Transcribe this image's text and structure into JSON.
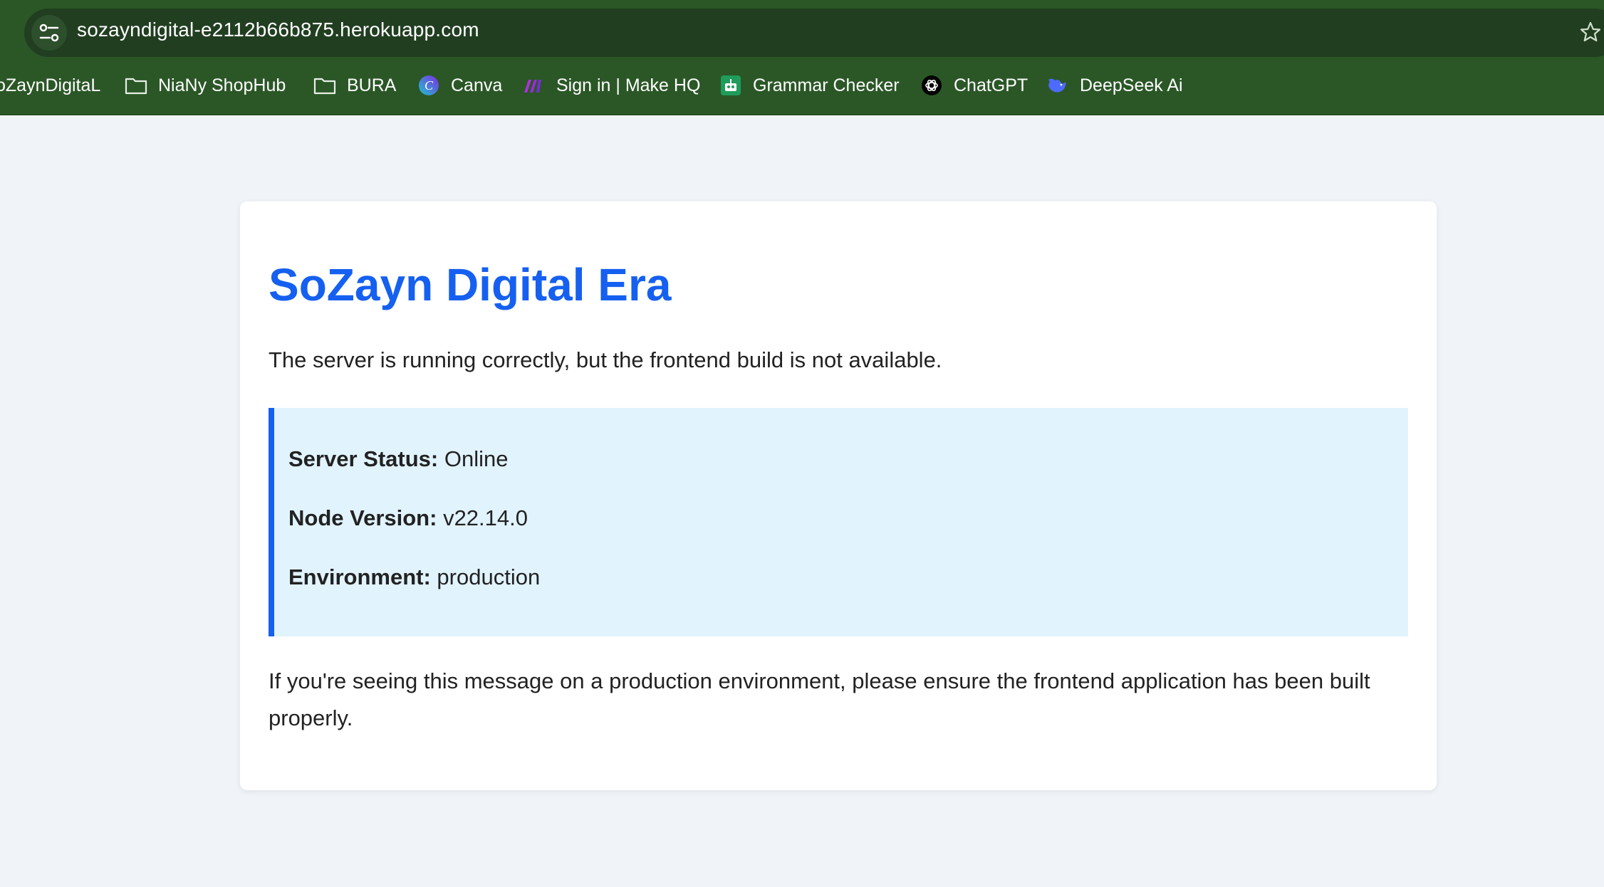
{
  "browser": {
    "url": "sozayndigital-e2112b66b875.herokuapp.com",
    "bookmarks": [
      {
        "label": "oZaynDigitaL",
        "icon": "none"
      },
      {
        "label": "NiaNy ShopHub",
        "icon": "folder-icon"
      },
      {
        "label": "BURA",
        "icon": "folder-icon"
      },
      {
        "label": "Canva",
        "icon": "canva-icon"
      },
      {
        "label": "Sign in | Make HQ",
        "icon": "make-icon"
      },
      {
        "label": "Grammar Checker",
        "icon": "grammar-icon"
      },
      {
        "label": "ChatGPT",
        "icon": "chatgpt-icon"
      },
      {
        "label": "DeepSeek Ai",
        "icon": "deepseek-icon"
      }
    ]
  },
  "page": {
    "title": "SoZayn Digital Era",
    "lead": "The server is running correctly, but the frontend build is not available.",
    "status": {
      "server_label": "Server Status:",
      "server_value": "Online",
      "node_label": "Node Version:",
      "node_value": "v22.14.0",
      "env_label": "Environment:",
      "env_value": "production"
    },
    "footnote": "If you're seeing this message on a production environment, please ensure the frontend application has been built properly."
  },
  "colors": {
    "chrome_green": "#2b5727",
    "address_bar": "#213e21",
    "accent_blue": "#1560f0",
    "status_bg": "#e1f3fd",
    "page_bg": "#f0f4f8"
  }
}
